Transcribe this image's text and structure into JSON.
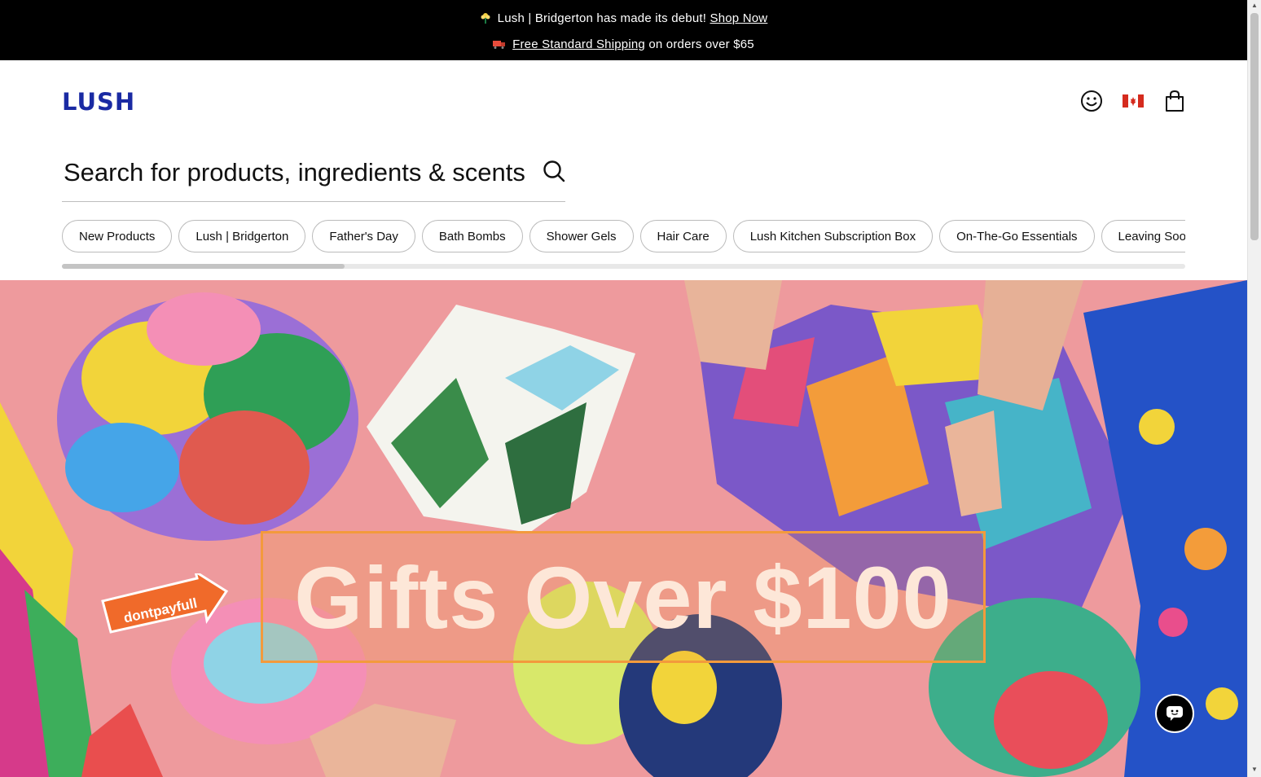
{
  "announcement": {
    "line1_text": "Lush | Bridgerton has made its debut!",
    "line1_link": "Shop Now",
    "line2_link": "Free Standard Shipping",
    "line2_text": "on orders over $65"
  },
  "header": {
    "logo": "LUSH",
    "account_icon": "smiley-icon",
    "country_icon": "canada-flag-icon",
    "cart_icon": "shopping-bag-icon"
  },
  "search": {
    "placeholder": "Search for products, ingredients & scents",
    "icon": "search-icon"
  },
  "categories": [
    "New Products",
    "Lush | Bridgerton",
    "Father's Day",
    "Bath Bombs",
    "Shower Gels",
    "Hair Care",
    "Lush Kitchen Subscription Box",
    "On-The-Go Essentials",
    "Leaving Soon"
  ],
  "hero": {
    "title": "Gifts Over $100",
    "badge": "dontpayfull"
  },
  "chat": {
    "icon": "chat-icon"
  },
  "colors": {
    "brand": "#1a2aa3",
    "announcement_bg": "#000000",
    "hero_bg": "#ee9a9d",
    "hero_box": "#f39a3c",
    "hero_text": "#fde7d8"
  }
}
